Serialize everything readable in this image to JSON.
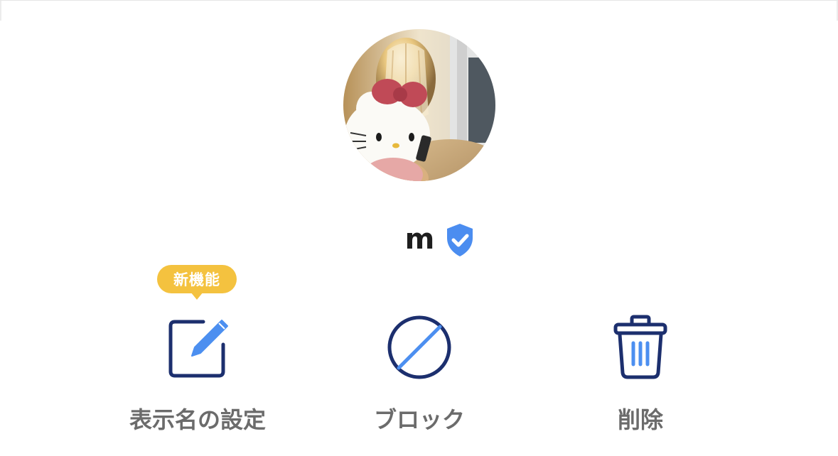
{
  "profile": {
    "display_name": "m",
    "verified": true,
    "avatar": "profile-photo"
  },
  "badge": {
    "label": "新機能"
  },
  "actions": [
    {
      "id": "rename",
      "label": "表示名の設定",
      "icon": "edit-pencil-icon"
    },
    {
      "id": "block",
      "label": "ブロック",
      "icon": "block-icon"
    },
    {
      "id": "delete",
      "label": "削除",
      "icon": "trash-icon"
    }
  ],
  "colors": {
    "icon_dark_blue": "#1c2f6e",
    "icon_accent_blue": "#4c8ff0",
    "verified_blue": "#4b8df0",
    "badge_yellow": "#f4c23f",
    "label_gray": "#6b6b6b",
    "name_black": "#1e1e1e"
  }
}
